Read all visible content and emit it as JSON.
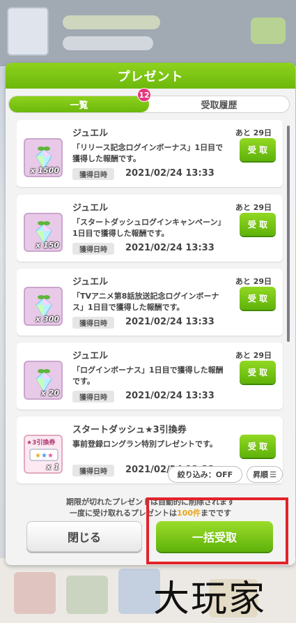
{
  "dialog": {
    "title": "プレゼント"
  },
  "tabs": [
    {
      "label": "一覧",
      "badge": "12"
    },
    {
      "label": "受取履歴"
    }
  ],
  "items": [
    {
      "name": "ジュエル",
      "qty": "x 1500",
      "desc": "「リリース記念ログインボーナス」1日目で獲得した報酬です。",
      "date_label": "獲得日時",
      "date": "2021/02/24 13:33",
      "days": "あと 29日",
      "button": "受 取",
      "icon": "jewel-icon"
    },
    {
      "name": "ジュエル",
      "qty": "x 150",
      "desc": "「スタートダッシュログインキャンペーン」1日目で獲得した報酬です。",
      "date_label": "獲得日時",
      "date": "2021/02/24 13:33",
      "days": "あと 29日",
      "button": "受 取",
      "icon": "jewel-icon"
    },
    {
      "name": "ジュエル",
      "qty": "x 300",
      "desc": "「TVアニメ第8話放送記念ログインボーナス」1日目で獲得した報酬です。",
      "date_label": "獲得日時",
      "date": "2021/02/24 13:33",
      "days": "あと 29日",
      "button": "受 取",
      "icon": "jewel-icon"
    },
    {
      "name": "ジュエル",
      "qty": "x 20",
      "desc": "「ログインボーナス」1日目で獲得した報酬です。",
      "date_label": "獲得日時",
      "date": "2021/02/24 13:33",
      "days": "あと 29日",
      "button": "受 取",
      "icon": "jewel-icon"
    },
    {
      "name": "スタートダッシュ★3引換券",
      "qty": "x 1",
      "desc": "事前登録ロングラン特別プレゼントです。",
      "date_label": "獲得日時",
      "date": "2021/02/24 13:33",
      "days": "",
      "button": "受 取",
      "icon": "ticket-icon",
      "ticket_label": "★3引換券"
    }
  ],
  "filter": {
    "label": "絞り込み：OFF"
  },
  "sort": {
    "label": "昇順"
  },
  "footer": {
    "note_line1": "期限が切れたプレゼントは自動的に削除されます",
    "note_line2_a": "一度に受け取れるプレゼントは",
    "note_line2_b": "100件",
    "note_line2_c": "までです",
    "close_label": "閉じる",
    "bulk_label": "一括受取"
  },
  "watermark": "大玩家",
  "colors": {
    "accent": "#6cb80c",
    "badge": "#e6357a",
    "highlight": "#e1242b"
  }
}
